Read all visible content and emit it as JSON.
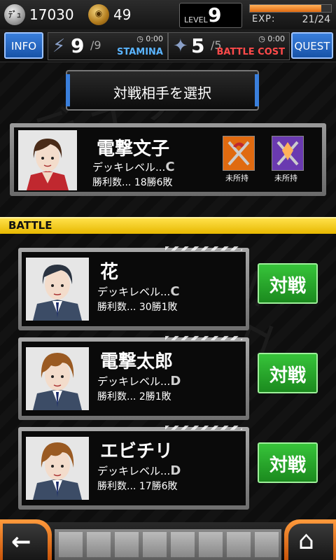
{
  "header": {
    "silver_coin_value": "17030",
    "gold_coin_value": "49",
    "silver_coin_glyph": "ﾃﾞｭ",
    "gold_coin_glyph": "◉",
    "level_label": "LEVEL",
    "level_value": "9",
    "exp_label": "EXP:",
    "exp_value": "21/24",
    "exp_fraction": 0.875
  },
  "statusbar": {
    "info_label": "INFO",
    "quest_label": "QUEST",
    "stamina": {
      "current": "9",
      "max": "/9",
      "timer": "0:00",
      "name": "STAMINA",
      "color": "#5ab4ff"
    },
    "battle_cost": {
      "current": "5",
      "max": "/5",
      "timer": "0:00",
      "name": "BATTLE COST",
      "color": "#ff4a4a"
    }
  },
  "page": {
    "title": "対戦相手を選択",
    "section_header": "BATTLE"
  },
  "player": {
    "name": "電撃文子",
    "deck_label": "デッキレベル...",
    "deck_rank": "C",
    "wins_label": "勝利数...",
    "wins_value": "18勝6敗",
    "items": [
      {
        "label": "未所持",
        "color": "#e06a10",
        "icon": "hammer-sickle-icon"
      },
      {
        "label": "未所持",
        "color": "#6a3ab0",
        "icon": "shield-crystal-icon"
      }
    ]
  },
  "opponents": [
    {
      "name": "花",
      "deck_label": "デッキレベル...",
      "deck_rank": "C",
      "wins_label": "勝利数...",
      "wins_value": "30勝1敗",
      "button": "対戦",
      "hair": "#2a3340"
    },
    {
      "name": "電撃太郎",
      "deck_label": "デッキレベル...",
      "deck_rank": "D",
      "wins_label": "勝利数...",
      "wins_value": "2勝1敗",
      "button": "対戦",
      "hair": "#9a5a22"
    },
    {
      "name": "エビチリ",
      "deck_label": "デッキレベル...",
      "deck_rank": "D",
      "wins_label": "勝利数...",
      "wins_value": "17勝6敗",
      "button": "対戦",
      "hair": "#9a5a22"
    }
  ],
  "background": {
    "watermark_1": "デュラ",
    "watermark_2": "デュラ"
  },
  "nav": {
    "back_icon": "←",
    "home_icon": "⌂"
  }
}
